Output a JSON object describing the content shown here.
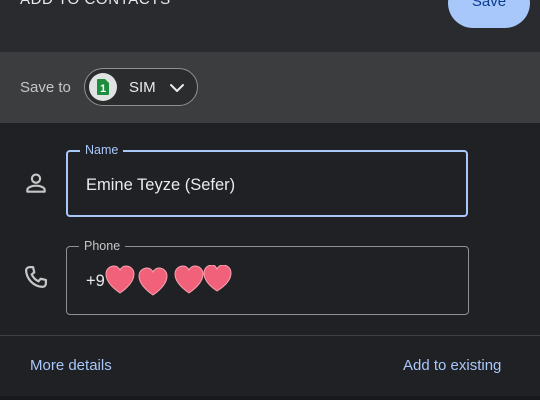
{
  "header": {
    "title": "ADD TO CONTACTS",
    "save_label": "Save"
  },
  "save_to": {
    "label": "Save to",
    "account_avatar": "1",
    "account_label": "SIM"
  },
  "form": {
    "name": {
      "label": "Name",
      "value": "Emine Teyze (Sefer)"
    },
    "phone": {
      "label": "Phone",
      "value": "+9",
      "redaction_icon": "heart-stickers"
    }
  },
  "footer": {
    "more_details": "More details",
    "add_to_existing": "Add to existing"
  },
  "colors": {
    "background": "#202124",
    "header": "#2a2b2e",
    "save_to_row": "#3c3d3e",
    "accent": "#a8c7fa",
    "sim_green": "#1e8e3e",
    "heart": "#f2617a"
  }
}
